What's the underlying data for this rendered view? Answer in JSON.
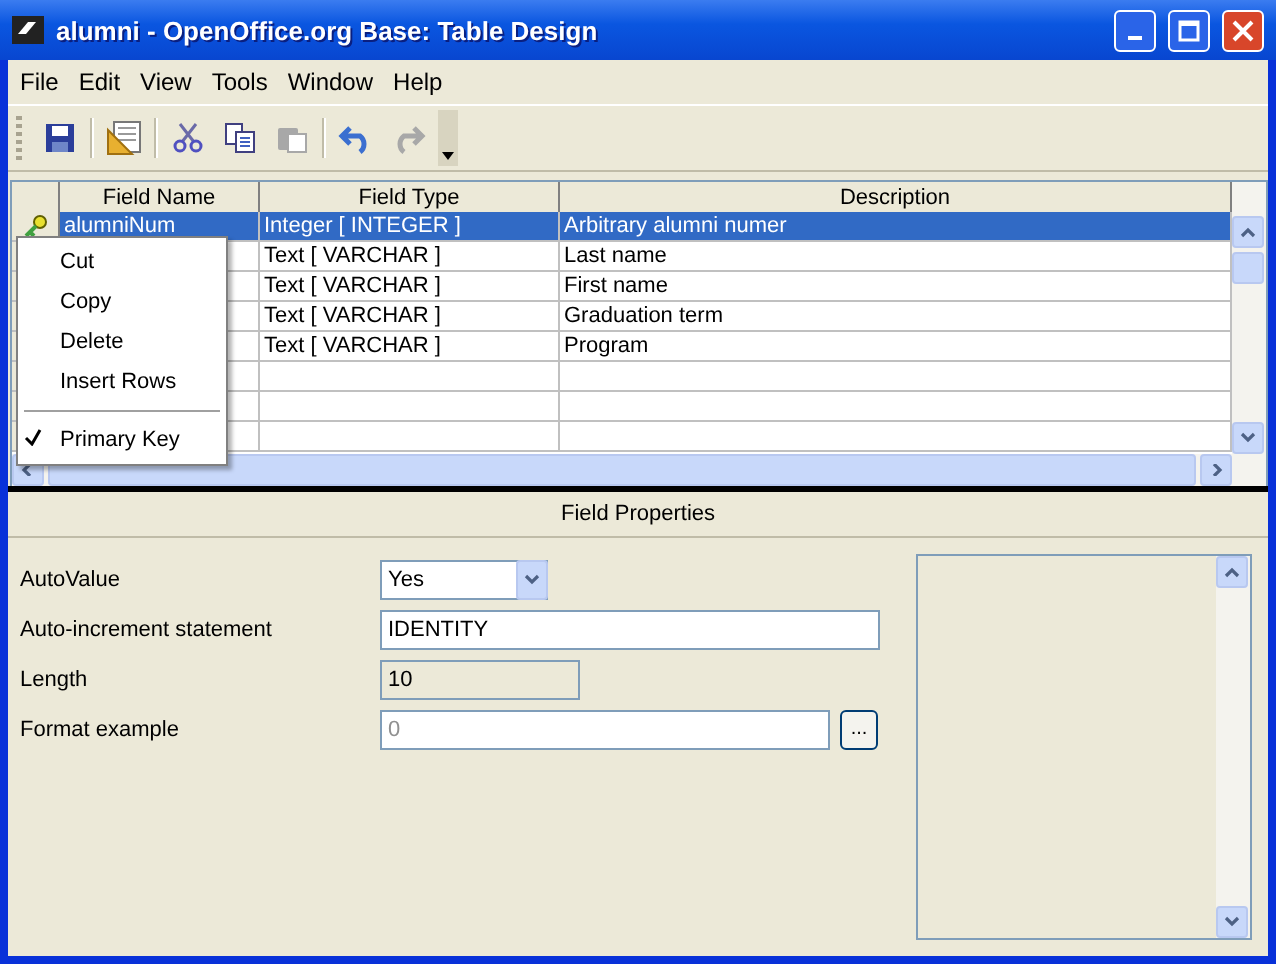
{
  "window": {
    "title": "alumni - OpenOffice.org Base: Table Design"
  },
  "menu": [
    "File",
    "Edit",
    "View",
    "Tools",
    "Window",
    "Help"
  ],
  "toolbar": [
    {
      "kind": "save",
      "disabled": false
    },
    {
      "kind": "sep"
    },
    {
      "kind": "design",
      "disabled": false
    },
    {
      "kind": "sep"
    },
    {
      "kind": "cut",
      "disabled": false
    },
    {
      "kind": "copy",
      "disabled": false
    },
    {
      "kind": "paste",
      "disabled": true
    },
    {
      "kind": "sep"
    },
    {
      "kind": "undo",
      "disabled": false
    },
    {
      "kind": "redo",
      "disabled": true
    }
  ],
  "table": {
    "columns": [
      "Field Name",
      "Field Type",
      "Description"
    ],
    "rows": [
      {
        "name": "alumniNum",
        "type": "Integer [ INTEGER ]",
        "description": "Arbitrary alumni numer",
        "selected": true,
        "primary_key": true
      },
      {
        "name": "",
        "type": "Text [ VARCHAR ]",
        "description": "Last name",
        "selected": false
      },
      {
        "name": "",
        "type": "Text [ VARCHAR ]",
        "description": "First name",
        "selected": false
      },
      {
        "name": "",
        "type": "Text [ VARCHAR ]",
        "description": "Graduation term",
        "selected": false
      },
      {
        "name": "",
        "type": "Text [ VARCHAR ]",
        "description": "Program",
        "selected": false
      }
    ]
  },
  "context_menu": [
    {
      "kind": "item",
      "label": "Cut",
      "checked": false
    },
    {
      "kind": "item",
      "label": "Copy",
      "checked": false
    },
    {
      "kind": "item",
      "label": "Delete",
      "checked": false
    },
    {
      "kind": "item",
      "label": "Insert Rows",
      "checked": false
    },
    {
      "kind": "separator"
    },
    {
      "kind": "item",
      "label": "Primary Key",
      "checked": true
    }
  ],
  "field_properties": {
    "title": "Field Properties",
    "rows": [
      {
        "kind": "select",
        "label": "AutoValue",
        "value": "Yes"
      },
      {
        "kind": "input",
        "label": "Auto-increment statement",
        "value": "IDENTITY"
      },
      {
        "kind": "readonly",
        "label": "Length",
        "value": "10"
      },
      {
        "kind": "browse",
        "label": "Format example",
        "value": "0",
        "disabled": true,
        "button": "..."
      }
    ]
  }
}
